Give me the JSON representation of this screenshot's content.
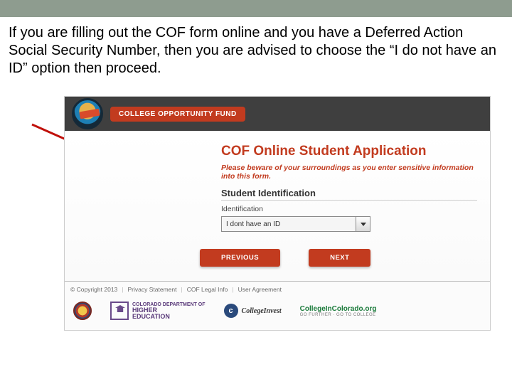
{
  "instruction_text": "If you are filling out the COF form online and you have a Deferred Action Social Security Number, then you are advised to choose the “I do not have an ID” option then proceed.",
  "header": {
    "pill_label": "COLLEGE OPPORTUNITY FUND"
  },
  "form": {
    "title": "COF Online Student Application",
    "warning": "Please beware of your surroundings as you enter sensitive information into this form.",
    "section_title": "Student Identification",
    "field_label": "Identification",
    "select_value": "I dont have an ID",
    "prev_label": "PREVIOUS",
    "next_label": "NEXT"
  },
  "footer": {
    "copyright": "© Copyright 2013",
    "links": [
      "Privacy Statement",
      "COF Legal Info",
      "User Agreement"
    ],
    "logos": {
      "higher_ed_line1": "COLORADO DEPARTMENT OF",
      "higher_ed_line2": "HIGHER",
      "higher_ed_line3": "EDUCATION",
      "collegeinvest": "CollegeInvest",
      "cic_main": "CollegeInColorado",
      "cic_suffix": ".org",
      "cic_tag": "GO FURTHER · GO TO COLLEGE"
    }
  }
}
